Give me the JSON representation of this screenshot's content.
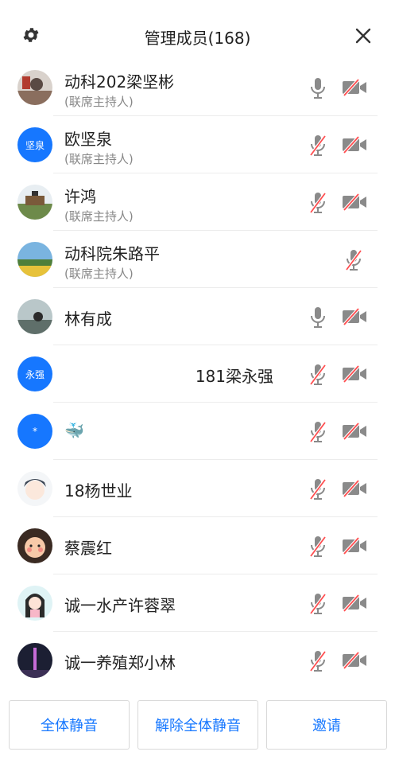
{
  "header": {
    "title": "管理成员(168)",
    "settings_icon": "gear-icon",
    "close_icon": "close-icon"
  },
  "colors": {
    "accent": "#1677ff",
    "mic_on": "#8a8a8a",
    "muted_slash": "#ff4d4f",
    "camera_off": "#8a8a8a"
  },
  "members": [
    {
      "name": "动科202梁坚彬",
      "role": "(联席主持人)",
      "avatar": "photo",
      "mic": "on",
      "camera": "off"
    },
    {
      "name": "欧坚泉",
      "role": "(联席主持人)",
      "avatar_text": "坚泉",
      "mic": "muted",
      "camera": "off"
    },
    {
      "name": "许鸿",
      "role": "(联席主持人)",
      "avatar": "photo",
      "mic": "muted",
      "camera": "off"
    },
    {
      "name": "动科院朱路平",
      "role": "(联席主持人)",
      "avatar": "photo",
      "mic": "muted",
      "camera": "none"
    },
    {
      "name": "林有成",
      "role": "",
      "avatar": "photo",
      "mic": "on",
      "camera": "off"
    },
    {
      "name": "181梁永强",
      "role": "",
      "avatar_text": "永强",
      "mic": "muted",
      "camera": "off"
    },
    {
      "name": "🐳",
      "role": "",
      "avatar_text": "*",
      "mic": "muted",
      "camera": "off"
    },
    {
      "name": "18杨世业",
      "role": "",
      "avatar": "photo",
      "mic": "muted",
      "camera": "off"
    },
    {
      "name": "蔡震红",
      "role": "",
      "avatar": "photo",
      "mic": "muted",
      "camera": "off"
    },
    {
      "name": "诚一水产许蓉翠",
      "role": "",
      "avatar": "photo",
      "mic": "muted",
      "camera": "off"
    },
    {
      "name": "诚一养殖郑小林",
      "role": "",
      "avatar": "photo",
      "mic": "muted",
      "camera": "off"
    }
  ],
  "footer": {
    "mute_all": "全体静音",
    "unmute_all": "解除全体静音",
    "invite": "邀请"
  }
}
